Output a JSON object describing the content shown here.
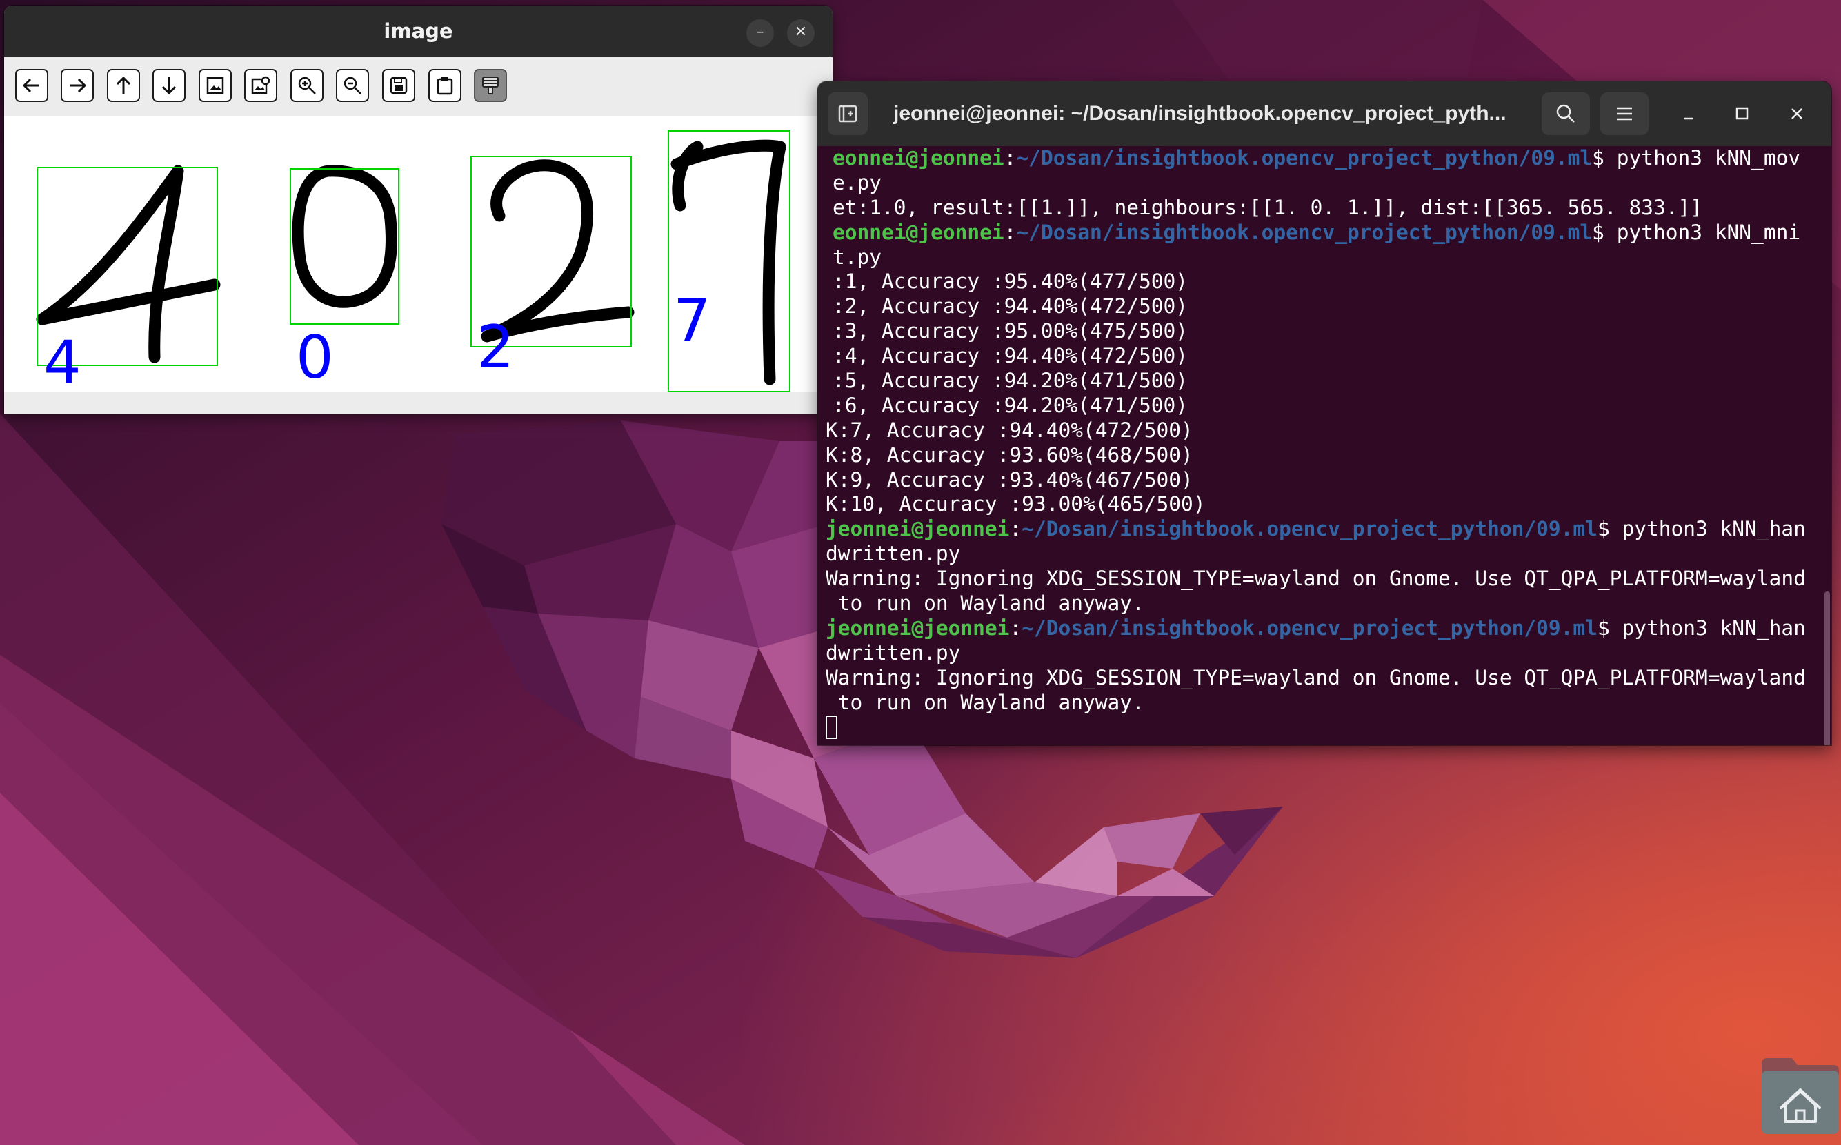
{
  "image_window": {
    "title": "image",
    "toolbar_icons": [
      "pan-left-icon",
      "pan-right-icon",
      "pan-up-icon",
      "pan-down-icon",
      "zoom-fit-icon",
      "zoom-original-icon",
      "zoom-in-icon",
      "zoom-out-icon",
      "save-icon",
      "copy-clipboard-icon",
      "properties-icon"
    ],
    "digits": [
      {
        "stroke": "4",
        "predicted": "4"
      },
      {
        "stroke": "0",
        "predicted": "0"
      },
      {
        "stroke": "2",
        "predicted": "2"
      },
      {
        "stroke": "7",
        "predicted": "7"
      }
    ],
    "box_color": "#00d400",
    "label_color": "#0000ff"
  },
  "terminal": {
    "title": "jeonnei@jeonnei: ~/Dosan/insightbook.opencv_project_pyth...",
    "prompt_user": "jeonnei@jeonnei",
    "prompt_path": "~/Dosan/insightbook.opencv_project_python/09.ml",
    "lines": [
      {
        "type": "prompt",
        "user": "eonnei@jeonnei",
        "path": "~/Dosan/insightbook.opencv_project_python/09.ml",
        "cmd": "$ python3 kNN_mov"
      },
      {
        "type": "out",
        "text": "e.py"
      },
      {
        "type": "out",
        "text": "et:1.0, result:[[1.]], neighbours:[[1. 0. 1.]], dist:[[365. 565. 833.]]"
      },
      {
        "type": "prompt",
        "user": "eonnei@jeonnei",
        "path": "~/Dosan/insightbook.opencv_project_python/09.ml",
        "cmd": "$ python3 kNN_mni"
      },
      {
        "type": "out",
        "text": "t.py"
      },
      {
        "type": "out",
        "text": ":1, Accuracy :95.40%(477/500)"
      },
      {
        "type": "out",
        "text": ":2, Accuracy :94.40%(472/500)"
      },
      {
        "type": "out",
        "text": ":3, Accuracy :95.00%(475/500)"
      },
      {
        "type": "out",
        "text": ":4, Accuracy :94.40%(472/500)"
      },
      {
        "type": "out",
        "text": ":5, Accuracy :94.20%(471/500)"
      },
      {
        "type": "out",
        "text": ":6, Accuracy :94.20%(471/500)"
      },
      {
        "type": "out",
        "text": "K:7, Accuracy :94.40%(472/500)"
      },
      {
        "type": "out",
        "text": "K:8, Accuracy :93.60%(468/500)"
      },
      {
        "type": "out",
        "text": "K:9, Accuracy :93.40%(467/500)"
      },
      {
        "type": "out",
        "text": "K:10, Accuracy :93.00%(465/500)"
      },
      {
        "type": "prompt",
        "user": "jeonnei@jeonnei",
        "path": "~/Dosan/insightbook.opencv_project_python/09.ml",
        "cmd": "$ python3 kNN_han"
      },
      {
        "type": "out",
        "text": "dwritten.py"
      },
      {
        "type": "out",
        "text": "Warning: Ignoring XDG_SESSION_TYPE=wayland on Gnome. Use QT_QPA_PLATFORM=wayland"
      },
      {
        "type": "out",
        "text": " to run on Wayland anyway."
      },
      {
        "type": "prompt",
        "user": "jeonnei@jeonnei",
        "path": "~/Dosan/insightbook.opencv_project_python/09.ml",
        "cmd": "$ python3 kNN_han"
      },
      {
        "type": "out",
        "text": "dwritten.py"
      },
      {
        "type": "out",
        "text": "Warning: Ignoring XDG_SESSION_TYPE=wayland on Gnome. Use QT_QPA_PLATFORM=wayland"
      },
      {
        "type": "out",
        "text": " to run on Wayland anyway."
      },
      {
        "type": "cursor"
      }
    ],
    "colors": {
      "background": "#300a24",
      "user": "#4ec34a",
      "path": "#3465a4",
      "text": "#ffffff"
    }
  },
  "desktop": {
    "dock_icon": "home-folder-icon",
    "wallpaper_colors": [
      "#2c0f28",
      "#7a2350",
      "#e05a3a"
    ]
  }
}
